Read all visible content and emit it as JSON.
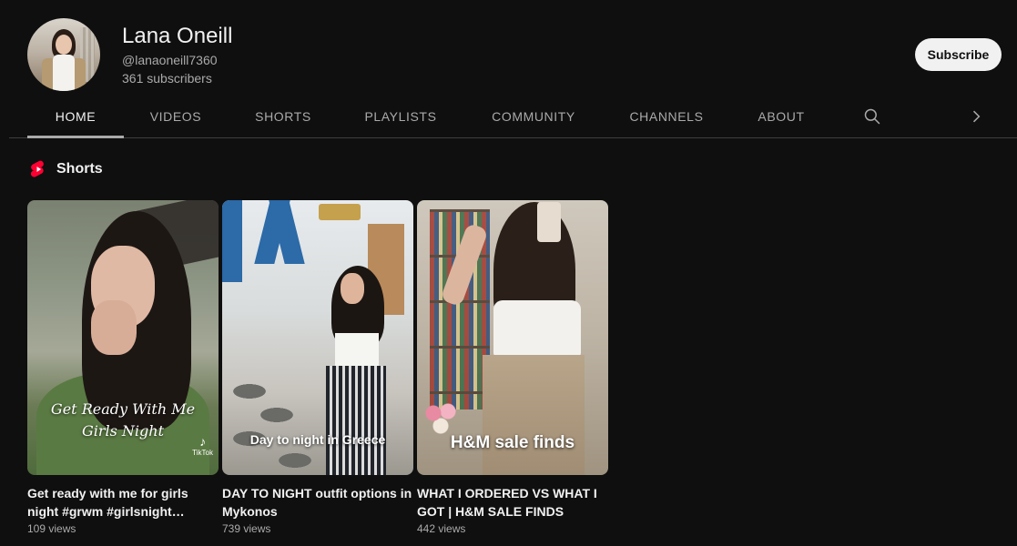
{
  "channel": {
    "name": "Lana Oneill",
    "handle": "@lanaoneill7360",
    "subscribers": "361 subscribers",
    "subscribe_label": "Subscribe"
  },
  "tabs": [
    {
      "label": "HOME",
      "active": true
    },
    {
      "label": "VIDEOS",
      "active": false
    },
    {
      "label": "SHORTS",
      "active": false
    },
    {
      "label": "PLAYLISTS",
      "active": false
    },
    {
      "label": "COMMUNITY",
      "active": false
    },
    {
      "label": "CHANNELS",
      "active": false
    },
    {
      "label": "ABOUT",
      "active": false
    }
  ],
  "icons": {
    "search": "search-icon",
    "next": "chevron-right-icon",
    "shorts": "shorts-logo-icon"
  },
  "colors": {
    "background": "#0f0f0f",
    "text": "#f1f1f1",
    "secondary_text": "#aaaaaa",
    "shorts_red": "#ff0033"
  },
  "shorts_section": {
    "title": "Shorts",
    "items": [
      {
        "overlay_line1": "Get Ready With Me",
        "overlay_line2": "Girls Night",
        "watermark": "TikTok",
        "title": "Get ready with me for girls night #grwm #girlsnight…",
        "views": "109 views"
      },
      {
        "overlay_line1": "Day to night in Greece",
        "title": "DAY TO NIGHT outfit options in Mykonos",
        "views": "739 views"
      },
      {
        "overlay_line1": "H&M sale finds",
        "title": "WHAT I ORDERED VS WHAT I GOT | H&M SALE FINDS",
        "views": "442 views"
      }
    ]
  }
}
